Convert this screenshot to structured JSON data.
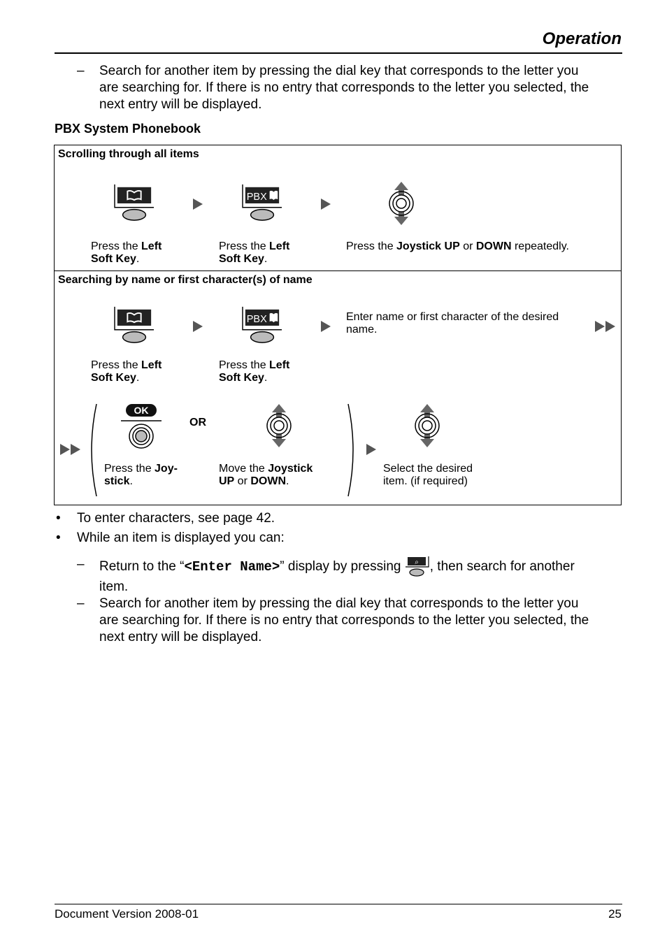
{
  "header": {
    "title": "Operation"
  },
  "intro": {
    "dash": "–",
    "lines": [
      "Search for another item by pressing the dial key that corresponds to the letter you",
      "are searching for. If there is no entry that corresponds to the letter you selected, the",
      "next entry will be displayed."
    ]
  },
  "section_title": "PBX System Phonebook",
  "table": {
    "row1": {
      "caption": "Scrolling through all items",
      "steps": [
        {
          "icon": "phonebook-soft-key-icon",
          "pre": "Press the ",
          "bold1": "Left",
          "line2_bold": "Soft Key",
          "line2_end": "."
        },
        {
          "icon": "pbx-phonebook-soft-key-icon",
          "display": "PBX",
          "pre": "Press the ",
          "bold1": "Left",
          "line2_bold": "Soft Key",
          "line2_end": "."
        },
        {
          "icon": "joystick-up-down-icon",
          "pre": "Press the ",
          "bold1": "Joystick UP",
          "mid": " or ",
          "bold2": "DOWN",
          "post": " repeatedly."
        }
      ]
    },
    "row2": {
      "caption": "Searching by name or first character(s) of name",
      "steps": [
        {
          "icon": "phonebook-soft-key-icon",
          "pre": "Press the ",
          "bold1": "Left",
          "line2_bold": "Soft Key",
          "line2_end": "."
        },
        {
          "icon": "pbx-phonebook-soft-key-icon",
          "display": "PBX",
          "pre": "Press the ",
          "bold1": "Left",
          "line2_bold": "Soft Key",
          "line2_end": "."
        },
        {
          "line1": "Enter name or first character of the desired",
          "line2": "name."
        }
      ],
      "sub": {
        "ok_label": "OK",
        "or_label": "OR",
        "press_pre": "Press the ",
        "press_bold": "Joy-",
        "press_bold2": "stick",
        "press_end": ".",
        "move_pre": "Move the ",
        "move_bold": "Joystick",
        "move_bold2": "UP",
        "move_mid": " or ",
        "move_bold3": "DOWN",
        "move_end": ".",
        "select_line1": "Select the desired",
        "select_line2": "item. (if required)"
      }
    }
  },
  "bullets": [
    "To enter characters, see page 42.",
    "While an item is displayed you can:"
  ],
  "bullet_char": "•",
  "sub_items": {
    "return_pre": "Return to the “",
    "return_code": "<Enter Name>",
    "return_mid": "” display by pressing ",
    "return_post": ", then search for another",
    "return_line2": "item.",
    "search_lines": [
      "Search for another item by pressing the dial key that corresponds to the letter you",
      "are searching for. If there is no entry that corresponds to the letter you selected, the",
      "next entry will be displayed."
    ]
  },
  "footer": {
    "version": "Document Version 2008-01",
    "page": "25"
  }
}
